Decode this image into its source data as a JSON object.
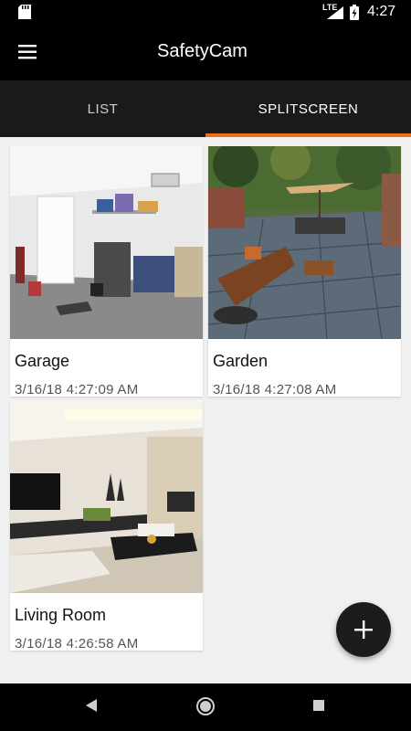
{
  "status_bar": {
    "network": "LTE",
    "time": "4:27",
    "icons": [
      "sd-card-icon",
      "signal-icon",
      "battery-charging-icon"
    ]
  },
  "app_bar": {
    "title": "SafetyCam",
    "menu_icon": "hamburger-menu-icon"
  },
  "tabs": [
    {
      "label": "LIST",
      "active": false
    },
    {
      "label": "SPLITSCREEN",
      "active": true
    }
  ],
  "cameras": [
    {
      "name": "Garage",
      "timestamp": "3/16/18 4:27:09 AM"
    },
    {
      "name": "Garden",
      "timestamp": "3/16/18 4:27:08 AM"
    },
    {
      "name": "Living Room",
      "timestamp": "3/16/18 4:26:58 AM"
    }
  ],
  "fab": {
    "icon": "plus-icon"
  },
  "nav_bar": {
    "icons": [
      "back-icon",
      "home-icon",
      "recents-icon"
    ]
  },
  "colors": {
    "accent": "#f26c1b",
    "bar": "#000000",
    "tabs_bg": "#1a1a1a"
  }
}
